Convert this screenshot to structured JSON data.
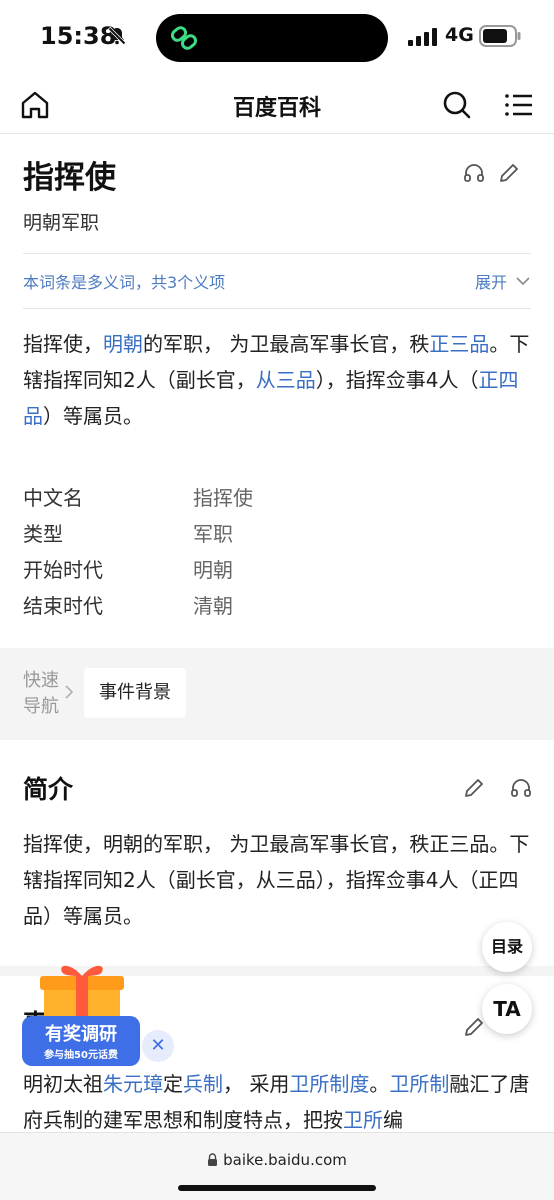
{
  "status_bar": {
    "time": "15:38",
    "network": "4G",
    "icons": [
      "bell-slash-icon",
      "link-icon",
      "signal-icon",
      "battery-icon"
    ]
  },
  "header": {
    "title": "百度百科",
    "icons": [
      "home-icon",
      "search-icon",
      "menu-icon"
    ]
  },
  "article": {
    "title": "指挥使",
    "subtitle": "明朝军职",
    "polysemy_notice": "本词条是多义词，共3个义项",
    "expand_label": "展开",
    "summary": [
      {
        "t": "指挥使，",
        "link": false
      },
      {
        "t": "明朝",
        "link": true
      },
      {
        "t": "的军职， 为卫最高军事长官，秩",
        "link": false
      },
      {
        "t": "正三品",
        "link": true
      },
      {
        "t": "。下辖指挥同知2人（副长官，",
        "link": false
      },
      {
        "t": "从三品",
        "link": true
      },
      {
        "t": "），指挥佥事4人（",
        "link": false
      },
      {
        "t": "正四品",
        "link": true
      },
      {
        "t": "）等属员。",
        "link": false
      }
    ],
    "infobox": [
      {
        "key": "中文名",
        "value": "指挥使"
      },
      {
        "key": "类型",
        "value": "军职"
      },
      {
        "key": "开始时代",
        "value": "明朝"
      },
      {
        "key": "结束时代",
        "value": "清朝"
      }
    ]
  },
  "quick_nav": {
    "label": "快速导航",
    "items": [
      "事件背景"
    ]
  },
  "sections": {
    "intro": {
      "heading": "简介",
      "text": "指挥使，明朝的军职， 为卫最高军事长官，秩正三品。下辖指挥同知2人（副长官，从三品），指挥佥事4人（正四品）等属员。"
    },
    "background": {
      "heading": "事件背景",
      "text": [
        {
          "t": "明初太祖",
          "link": false
        },
        {
          "t": "朱元璋",
          "link": true
        },
        {
          "t": "定",
          "link": false
        },
        {
          "t": "兵制",
          "link": true
        },
        {
          "t": "， 采用",
          "link": false
        },
        {
          "t": "卫所制度",
          "link": true
        },
        {
          "t": "。",
          "link": false
        },
        {
          "t": "卫所制",
          "link": true
        },
        {
          "t": "融汇了唐府兵制的建军思想和制度特点，把按",
          "link": false
        },
        {
          "t": "卫所",
          "link": true
        },
        {
          "t": "编",
          "link": false
        }
      ]
    }
  },
  "floating": {
    "toc_label": "目录",
    "ta_label": "TA",
    "promo_title": "有奖调研",
    "promo_sub": "参与抽50元话费",
    "promo_close": "✕"
  },
  "url_bar": {
    "url": "baike.baidu.com"
  },
  "colors": {
    "link": "#3a6fc4",
    "accent": "#4e7bc2",
    "promo": "#3e6fe6"
  }
}
